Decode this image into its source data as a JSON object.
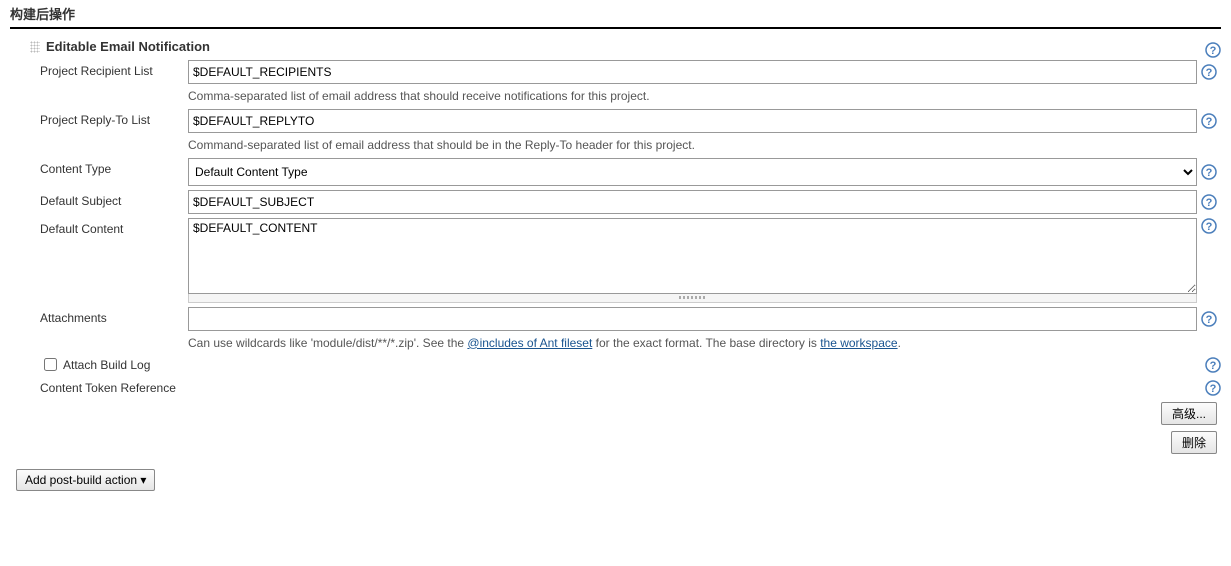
{
  "section": {
    "title": "构建后操作"
  },
  "block": {
    "title": "Editable Email Notification"
  },
  "recipientList": {
    "label": "Project Recipient List",
    "value": "$DEFAULT_RECIPIENTS",
    "description": "Comma-separated list of email address that should receive notifications for this project."
  },
  "replyToList": {
    "label": "Project Reply-To List",
    "value": "$DEFAULT_REPLYTO",
    "description": "Command-separated list of email address that should be in the Reply-To header for this project."
  },
  "contentType": {
    "label": "Content Type",
    "selected": "Default Content Type"
  },
  "defaultSubject": {
    "label": "Default Subject",
    "value": "$DEFAULT_SUBJECT"
  },
  "defaultContent": {
    "label": "Default Content",
    "value": "$DEFAULT_CONTENT"
  },
  "attachments": {
    "label": "Attachments",
    "value": "",
    "descPrefix": "Can use wildcards like 'module/dist/**/*.zip'. See the ",
    "link1": "@includes of Ant fileset",
    "descMid": " for the exact format. The base directory is ",
    "link2": "the workspace",
    "descSuffix": "."
  },
  "attachBuildLog": {
    "label": "Attach Build Log"
  },
  "tokenRef": {
    "label": "Content Token Reference"
  },
  "buttons": {
    "advanced": "高级...",
    "delete": "删除",
    "addAction": "Add post-build action ▾"
  }
}
